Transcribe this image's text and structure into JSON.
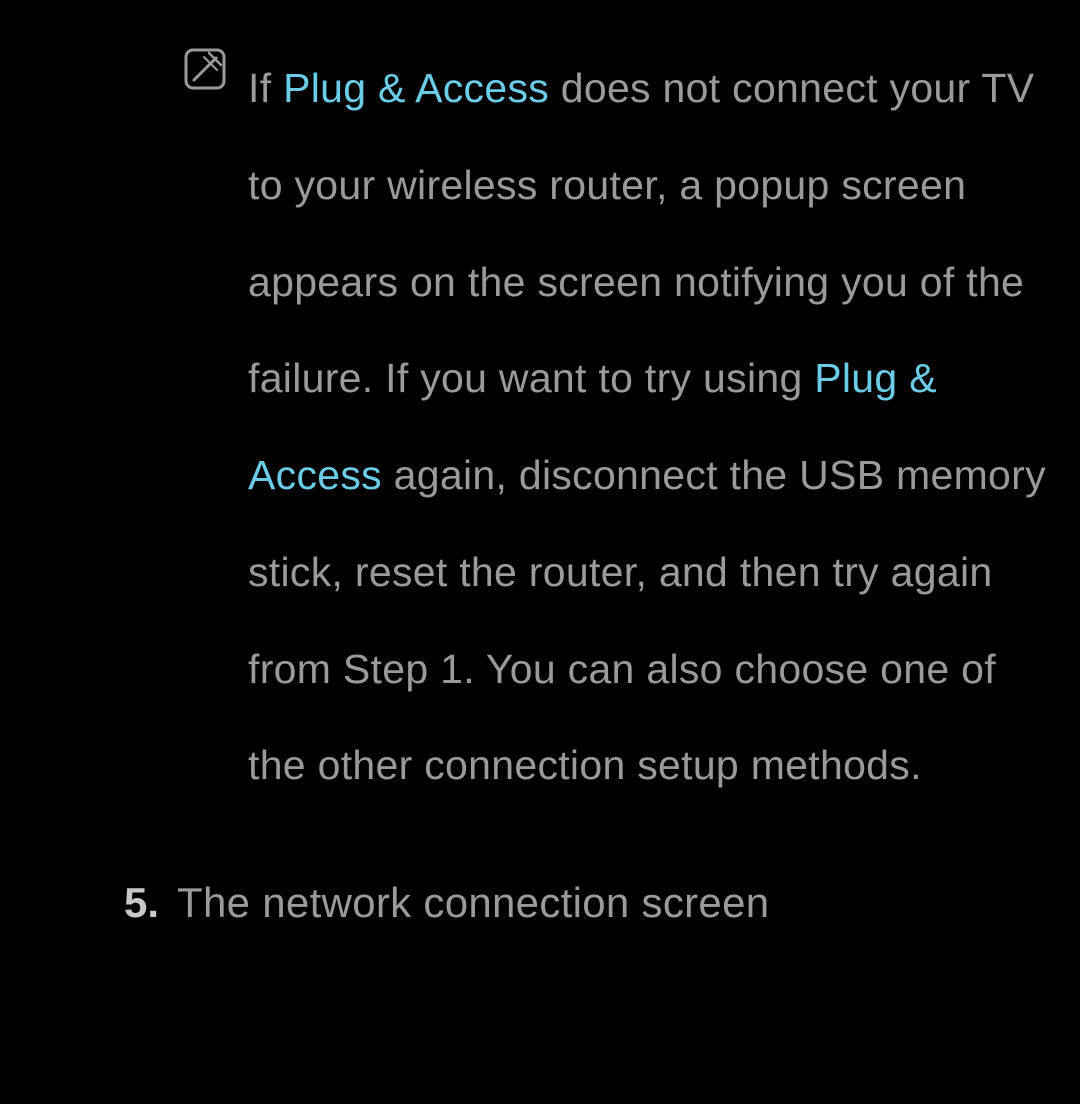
{
  "note": {
    "text_before_hl1": "If ",
    "highlight1": "Plug & Access",
    "text_between": " does not connect your TV to your wireless router, a popup screen appears on the screen notifying you of the failure. If you want to try using ",
    "highlight2": "Plug & Access",
    "text_after_hl2": " again, disconnect the USB memory stick, reset the router, and then try again from Step 1. You can also choose one of the other connection setup methods."
  },
  "step": {
    "number": "5.",
    "text": "The network connection screen"
  }
}
